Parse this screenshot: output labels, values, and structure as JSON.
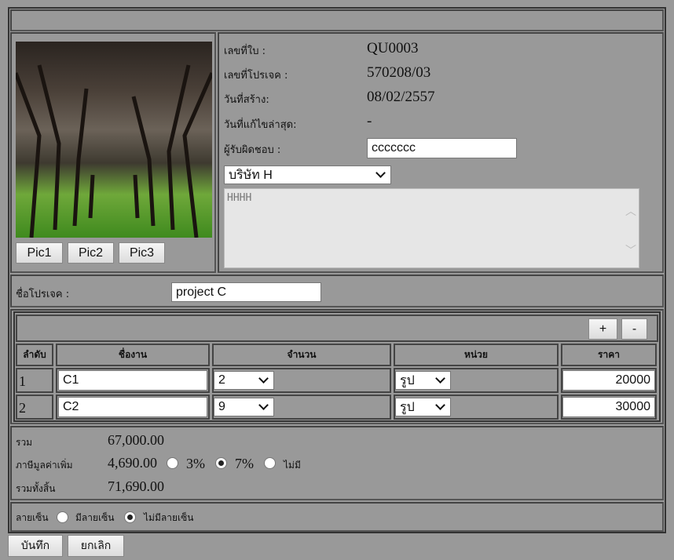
{
  "images": {
    "buttons": [
      "Pic1",
      "Pic2",
      "Pic3"
    ]
  },
  "info": {
    "doc_no_label": "เลขที่ใบ :",
    "doc_no": "QU0003",
    "project_no_label": "เลขที่โปรเจค :",
    "project_no": "570208/03",
    "created_label": "วันที่สร้าง:",
    "created": "08/02/2557",
    "modified_label": "วันที่แก้ไขล่าสุด:",
    "modified": "-",
    "responsible_label": "ผู้รับผิดชอบ :",
    "responsible": "ccccccc",
    "company": "บริษัท H",
    "notes": "HHHH"
  },
  "project": {
    "label": "ชื่อโปรเจค :",
    "value": "project C"
  },
  "items": {
    "add_label": "+",
    "remove_label": "-",
    "headers": [
      "ลำดับ",
      "ชื่องาน",
      "จำนวน",
      "หน่วย",
      "ราคา"
    ],
    "rows": [
      {
        "no": "1",
        "name": "C1",
        "qty": "2",
        "unit": "รูป",
        "price": "20000"
      },
      {
        "no": "2",
        "name": "C2",
        "qty": "9",
        "unit": "รูป",
        "price": "30000"
      }
    ]
  },
  "totals": {
    "subtotal_label": "รวม",
    "subtotal": "67,000.00",
    "vat_label": "ภาษีมูลค่าเพิ่ม",
    "vat": "4,690.00",
    "vat_options": [
      "3%",
      "7%",
      "ไม่มี"
    ],
    "vat_selected": "7%",
    "grand_label": "รวมทั้งสิ้น",
    "grand": "71,690.00"
  },
  "signature": {
    "label": "ลายเซ็น",
    "options": [
      "มีลายเซ็น",
      "ไม่มีลายเซ็น"
    ],
    "selected": "ไม่มีลายเซ็น"
  },
  "actions": {
    "save": "บันทึก",
    "cancel": "ยกเลิก"
  }
}
